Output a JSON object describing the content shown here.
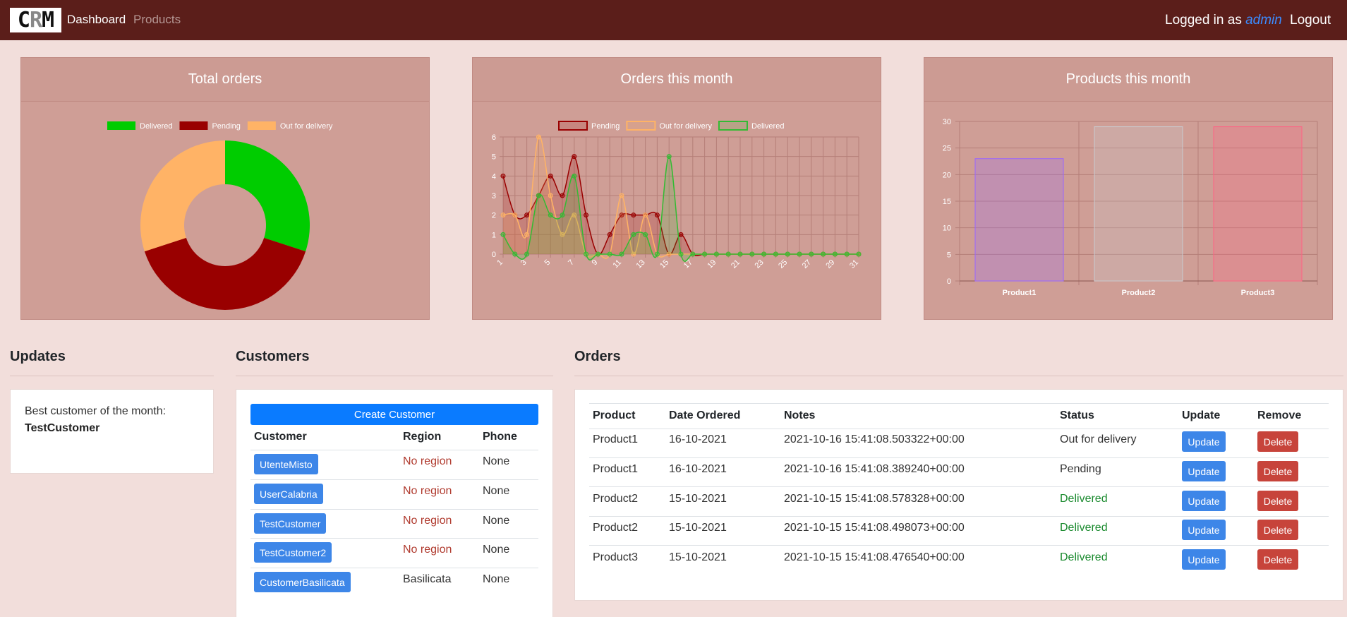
{
  "nav": {
    "logo_c": "C",
    "logo_r": "R",
    "logo_m": "M",
    "dashboard": "Dashboard",
    "products": "Products",
    "logged_prefix": "Logged in as ",
    "user": "admin",
    "logout": "Logout"
  },
  "colors": {
    "navbar": "#5b1e1a",
    "card": "#cf9e96",
    "delivered": "#00cc00",
    "pending": "#990000",
    "out_for_delivery": "#ffb366",
    "primary_button": "#3d86e8",
    "danger_button": "#c7443b"
  },
  "cards": {
    "total_orders": "Total orders",
    "orders_month": "Orders this month",
    "products_month": "Products this month"
  },
  "chart_data": [
    {
      "type": "pie",
      "title": "Total orders",
      "legend_position": "top",
      "categories": [
        "Delivered",
        "Pending",
        "Out for delivery"
      ],
      "values": [
        3,
        4,
        3
      ],
      "colors": [
        "#00cc00",
        "#990000",
        "#ffb366"
      ]
    },
    {
      "type": "line",
      "title": "Orders this month",
      "legend_position": "top",
      "x": [
        1,
        2,
        3,
        4,
        5,
        6,
        7,
        8,
        9,
        10,
        11,
        12,
        13,
        14,
        15,
        16,
        17,
        18,
        19,
        20,
        21,
        22,
        23,
        24,
        25,
        26,
        27,
        28,
        29,
        30,
        31
      ],
      "x_tick_labels": [
        "1",
        "3",
        "5",
        "7",
        "9",
        "11",
        "13",
        "15",
        "17",
        "19",
        "21",
        "23",
        "25",
        "27",
        "29",
        "31"
      ],
      "ylim": [
        0,
        6
      ],
      "y_ticks": [
        "0",
        "1",
        "2",
        "3",
        "4",
        "5",
        "6"
      ],
      "grid": true,
      "series": [
        {
          "name": "Pending",
          "color": "#990000",
          "values": [
            4,
            2,
            2,
            3,
            4,
            3,
            5,
            2,
            0,
            1,
            2,
            2,
            2,
            2,
            0,
            1,
            0,
            0,
            0,
            0,
            0,
            0,
            0,
            0,
            0,
            0,
            0,
            0,
            0,
            0,
            0
          ]
        },
        {
          "name": "Out for delivery",
          "color": "#ffb366",
          "values": [
            2,
            2,
            1,
            6,
            3,
            1,
            2,
            0,
            0,
            0,
            3,
            0,
            2,
            0,
            0,
            0,
            0,
            0,
            0,
            0,
            0,
            0,
            0,
            0,
            0,
            0,
            0,
            0,
            0,
            0,
            0
          ]
        },
        {
          "name": "Delivered",
          "color": "#33bb33",
          "values": [
            1,
            0,
            0,
            3,
            2,
            2,
            4,
            0,
            0,
            0,
            0,
            1,
            1,
            0,
            5,
            0,
            0,
            0,
            0,
            0,
            0,
            0,
            0,
            0,
            0,
            0,
            0,
            0,
            0,
            0,
            0
          ]
        }
      ]
    },
    {
      "type": "bar",
      "title": "Products this month",
      "categories": [
        "Product1",
        "Product2",
        "Product3"
      ],
      "values": [
        23,
        29,
        29
      ],
      "ylim": [
        0,
        30
      ],
      "y_ticks": [
        "0",
        "5",
        "10",
        "15",
        "20",
        "25",
        "30"
      ],
      "grid": true,
      "colors": [
        "#9966ff",
        "#c9cbcf",
        "#ff6384"
      ]
    }
  ],
  "updates": {
    "title": "Updates",
    "best_label": "Best customer of the month:",
    "best_name": "TestCustomer"
  },
  "customers": {
    "title": "Customers",
    "create_button": "Create Customer",
    "headers": [
      "Customer",
      "Region",
      "Phone"
    ],
    "rows": [
      {
        "name": "UtenteMisto",
        "region": "No region",
        "phone": "None"
      },
      {
        "name": "UserCalabria",
        "region": "No region",
        "phone": "None"
      },
      {
        "name": "TestCustomer",
        "region": "No region",
        "phone": "None"
      },
      {
        "name": "TestCustomer2",
        "region": "No region",
        "phone": "None"
      },
      {
        "name": "CustomerBasilicata",
        "region": "Basilicata",
        "phone": "None"
      }
    ]
  },
  "orders": {
    "title": "Orders",
    "headers": [
      "Product",
      "Date Ordered",
      "Notes",
      "Status",
      "Update",
      "Remove"
    ],
    "update_label": "Update",
    "delete_label": "Delete",
    "rows": [
      {
        "product": "Product1",
        "date": "16-10-2021",
        "notes": "2021-10-16 15:41:08.503322+00:00",
        "status": "Out for delivery"
      },
      {
        "product": "Product1",
        "date": "16-10-2021",
        "notes": "2021-10-16 15:41:08.389240+00:00",
        "status": "Pending"
      },
      {
        "product": "Product2",
        "date": "15-10-2021",
        "notes": "2021-10-15 15:41:08.578328+00:00",
        "status": "Delivered"
      },
      {
        "product": "Product2",
        "date": "15-10-2021",
        "notes": "2021-10-15 15:41:08.498073+00:00",
        "status": "Delivered"
      },
      {
        "product": "Product3",
        "date": "15-10-2021",
        "notes": "2021-10-15 15:41:08.476540+00:00",
        "status": "Delivered"
      }
    ]
  }
}
